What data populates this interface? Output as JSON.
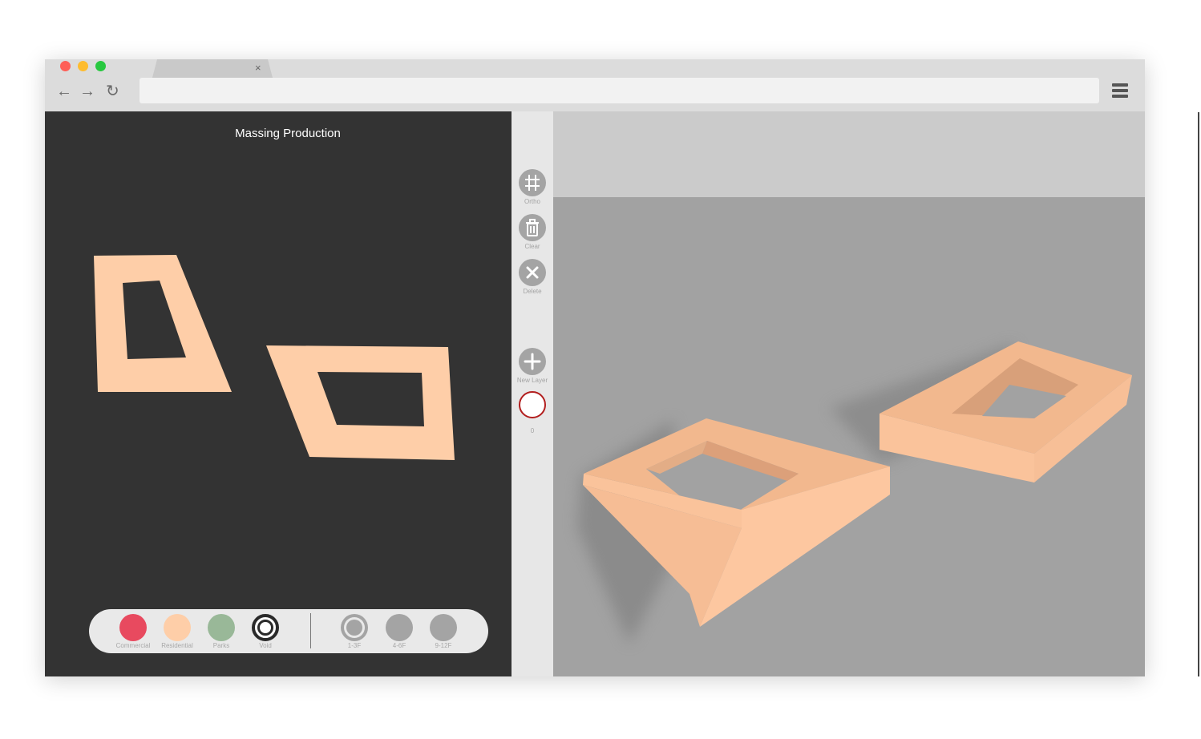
{
  "browser": {
    "tab_close": "×",
    "back_icon": "←",
    "forward_icon": "→",
    "reload_icon": "↻",
    "url": "",
    "traffic_colors": [
      "#fe5f57",
      "#febc2e",
      "#28c840"
    ]
  },
  "panel": {
    "title": "Massing Production"
  },
  "palette": {
    "types": [
      {
        "label": "Commercial",
        "color": "#e84a5f"
      },
      {
        "label": "Residential",
        "color": "#fecea8"
      },
      {
        "label": "Parks",
        "color": "#99b898"
      },
      {
        "label": "Void",
        "color": "#2a2a2a"
      }
    ],
    "heights": [
      {
        "label": "1-3F",
        "color": "#a4a4a4"
      },
      {
        "label": "4-6F",
        "color": "#a4a4a4"
      },
      {
        "label": "9-12F",
        "color": "#a4a4a4"
      }
    ]
  },
  "toolbar": {
    "ortho_label": "Ortho",
    "clear_label": "Clear",
    "delete_label": "Delete",
    "new_layer_label": "New Layer",
    "layer_count": "0"
  },
  "colors": {
    "massing_fill": "#fecea8",
    "canvas_bg": "#333333",
    "viewport_ground": "#a2a2a2",
    "viewport_sky": "#cbcbcb",
    "layer_ring": "#b21e1e"
  }
}
